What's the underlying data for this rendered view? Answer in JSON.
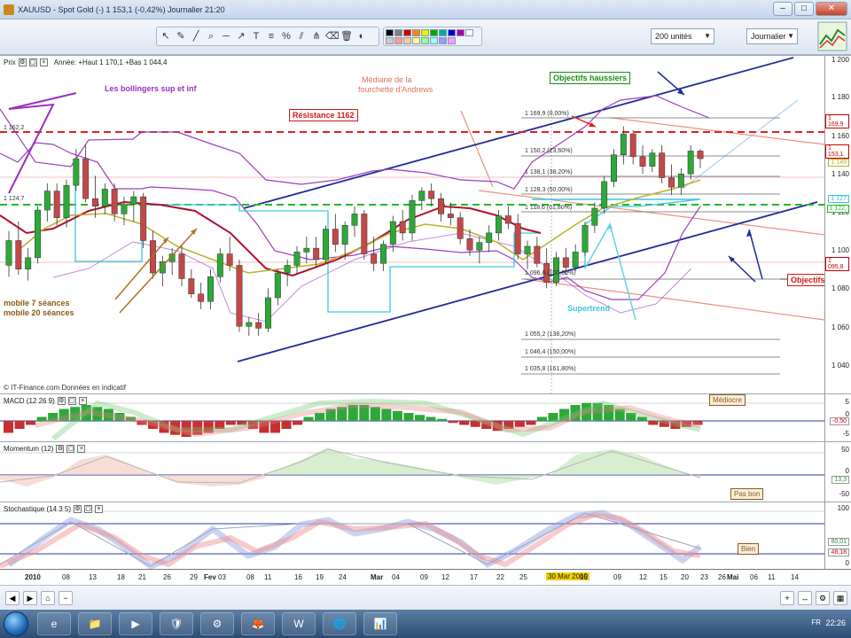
{
  "window": {
    "title": "XAUUSD - Spot Gold (-)   1 153,1 (-0,42%)   Journalier  21:20",
    "minimize": "–",
    "maximize": "□",
    "close": "✕"
  },
  "toolbar": {
    "tools": [
      "cursor-icon",
      "pencil-icon",
      "line-icon",
      "zoom-icon",
      "hline-icon",
      "trendline-icon",
      "text-icon",
      "fibo-icon",
      "percent-icon",
      "channel-icon",
      "eraser-icon",
      "trash-icon"
    ],
    "units_select": "200 unités",
    "period_select": "Journalier"
  },
  "main_panel": {
    "label": "Prix",
    "info": "Année: +Haut 1 170,1 +Bas 1 044,4",
    "copyright": "© IT-Finance.com  Données en indicatif",
    "y_ticks": [
      "1 200",
      "1 180",
      "1 160",
      "1 140",
      "1 120",
      "1 100",
      "1 080",
      "1 060",
      "1 040"
    ],
    "price_tags": [
      "1 169,9",
      "1 153,1",
      "1 149",
      "1 127",
      "1 122,",
      "1 095,8"
    ],
    "annotations": {
      "bollinger": "Les bollingers sup et inf",
      "mediane_1": "Médiane de la",
      "mediane_2": "fourchette d'Andrews",
      "resistance": "Résistance 1162",
      "objectifs_haussiers": "Objectifs haussiers",
      "objectifs": "Objectifs",
      "supertrend": "Supertrend",
      "mm7": "mobile 7 séances",
      "mm20": "mobile 20 séances",
      "level_1162": "1 162,2",
      "level_1124": "1 124,7"
    },
    "fibo_levels": [
      "1 169,9 (0,00%)",
      "1 150,2 (23,60%)",
      "1 138,1 (38,20%)",
      "1 128,3 (50,00%)",
      "1 118,6 (61,80%)",
      "1 096,6 (100,00%)",
      "1 055,2 (138,20%)",
      "1 046,4 (150,00%)",
      "1 035,8 (161,80%)"
    ]
  },
  "macd_panel": {
    "label": "MACD (12 26 9)",
    "y_ticks": [
      "5",
      "0",
      "-5"
    ],
    "tag": "Médiocre",
    "value_tag": "-0,50"
  },
  "momentum_panel": {
    "label": "Momentum (12)",
    "y_ticks": [
      "50",
      "0",
      "-50"
    ],
    "tag": "Pas bon",
    "value_tag": "13,3"
  },
  "stoch_panel": {
    "label": "Stochastique (14 3 5)",
    "y_ticks": [
      "100",
      "0"
    ],
    "tag": "Bien",
    "value_tags": [
      "80,01",
      "48,18"
    ]
  },
  "date_axis": {
    "labels": [
      "2010",
      "08",
      "13",
      "18",
      "21",
      "26",
      "29",
      "Fev",
      "03",
      "08",
      "11",
      "16",
      "19",
      "24",
      "Mar",
      "04",
      "09",
      "12",
      "17",
      "22",
      "25",
      "30 Mar 2010",
      "06",
      "09",
      "12",
      "15",
      "20",
      "23",
      "26",
      "Mai",
      "06",
      "11",
      "14"
    ]
  },
  "taskbar": {
    "apps": [
      "e",
      "📁",
      "▶",
      "🛡",
      "⚙",
      "🦊",
      "W",
      "🌐",
      "📊"
    ],
    "tray": "FR",
    "clock": "22:26"
  },
  "colors": {
    "resistance": "#e02020",
    "support_green": "#22bb22",
    "channel": "#1f2a9a",
    "bollinger": "#9a40c0",
    "supertrend": "#3cc6e0",
    "ma7": "#b9b12a",
    "ma20": "#b01030",
    "bull": "#2da839",
    "bear": "#c44848"
  }
}
